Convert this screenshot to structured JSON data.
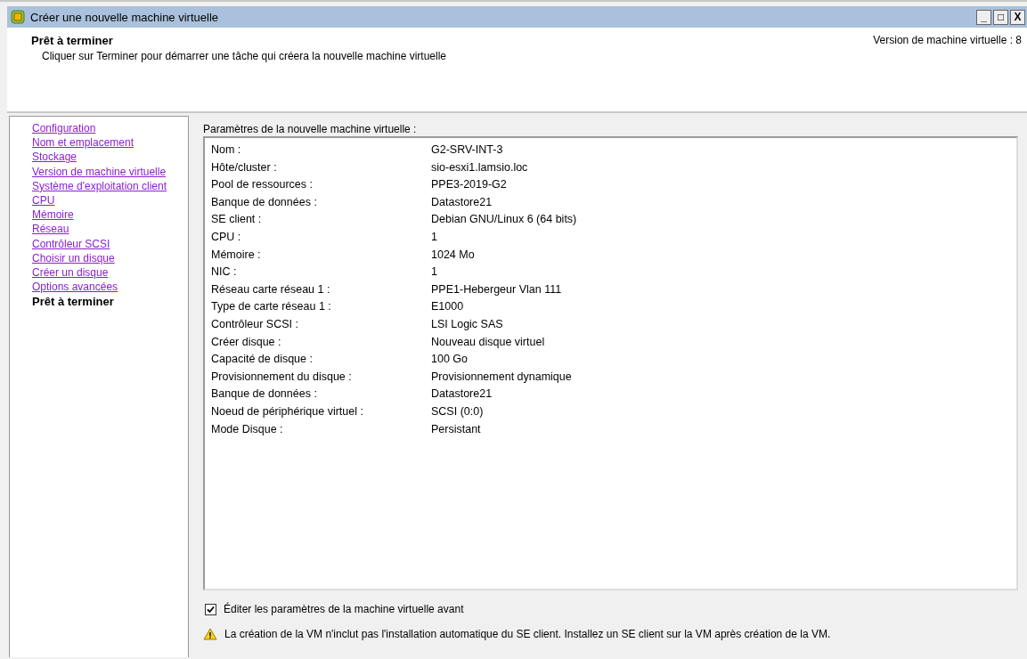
{
  "window": {
    "title": "Créer une nouvelle machine virtuelle",
    "controls": [
      "_",
      "□",
      "X"
    ]
  },
  "header": {
    "title": "Prêt à terminer",
    "subtitle": "Cliquer sur Terminer pour démarrer une tâche qui créera la nouvelle machine virtuelle",
    "version": "Version de machine virtuelle : 8"
  },
  "sidebar": {
    "items": [
      {
        "label": "Configuration",
        "selected": false
      },
      {
        "label": "Nom et emplacement",
        "selected": false
      },
      {
        "label": "Stockage",
        "selected": false
      },
      {
        "label": "Version de machine virtuelle",
        "selected": false
      },
      {
        "label": "Système d'exploitation client",
        "selected": false
      },
      {
        "label": "CPU",
        "selected": false
      },
      {
        "label": "Mémoire",
        "selected": false
      },
      {
        "label": "Réseau",
        "selected": false
      },
      {
        "label": "Contrôleur SCSI",
        "selected": false
      },
      {
        "label": "Choisir un disque",
        "selected": false
      },
      {
        "label": "Créer un disque",
        "selected": false
      },
      {
        "label": "Options avancées",
        "selected": false
      },
      {
        "label": "Prêt à terminer",
        "selected": true
      }
    ]
  },
  "settings": {
    "label": "Paramètres de la nouvelle machine virtuelle :",
    "rows": [
      {
        "name": "Nom :",
        "value": "G2-SRV-INT-3"
      },
      {
        "name": "Hôte/cluster :",
        "value": "sio-esxi1.lamsio.loc"
      },
      {
        "name": "Pool de ressources :",
        "value": "PPE3-2019-G2"
      },
      {
        "name": "Banque de données :",
        "value": "Datastore21"
      },
      {
        "name": "SE client :",
        "value": "Debian GNU/Linux 6 (64 bits)"
      },
      {
        "name": "CPU :",
        "value": "1"
      },
      {
        "name": "Mémoire :",
        "value": "1024 Mo"
      },
      {
        "name": "NIC :",
        "value": "1"
      },
      {
        "name": "Réseau carte réseau 1 :",
        "value": "PPE1-Hebergeur Vlan 111"
      },
      {
        "name": "Type de carte réseau 1 :",
        "value": "E1000"
      },
      {
        "name": "Contrôleur SCSI :",
        "value": "LSI Logic SAS"
      },
      {
        "name": "Créer disque :",
        "value": "Nouveau disque virtuel"
      },
      {
        "name": "Capacité de disque :",
        "value": "100 Go"
      },
      {
        "name": "Provisionnement du disque :",
        "value": "Provisionnement dynamique"
      },
      {
        "name": "Banque de données :",
        "value": "Datastore21"
      },
      {
        "name": "Noeud de périphérique virtuel :",
        "value": "SCSI (0:0)"
      },
      {
        "name": "Mode Disque :",
        "value": "Persistant"
      }
    ]
  },
  "edit_option": {
    "label": "Éditer les paramètres de la machine virtuelle avant",
    "checked": true
  },
  "warning": "La création de la VM n'inclut pas l'installation automatique du SE client. Installez un SE client sur la VM après création de la VM."
}
